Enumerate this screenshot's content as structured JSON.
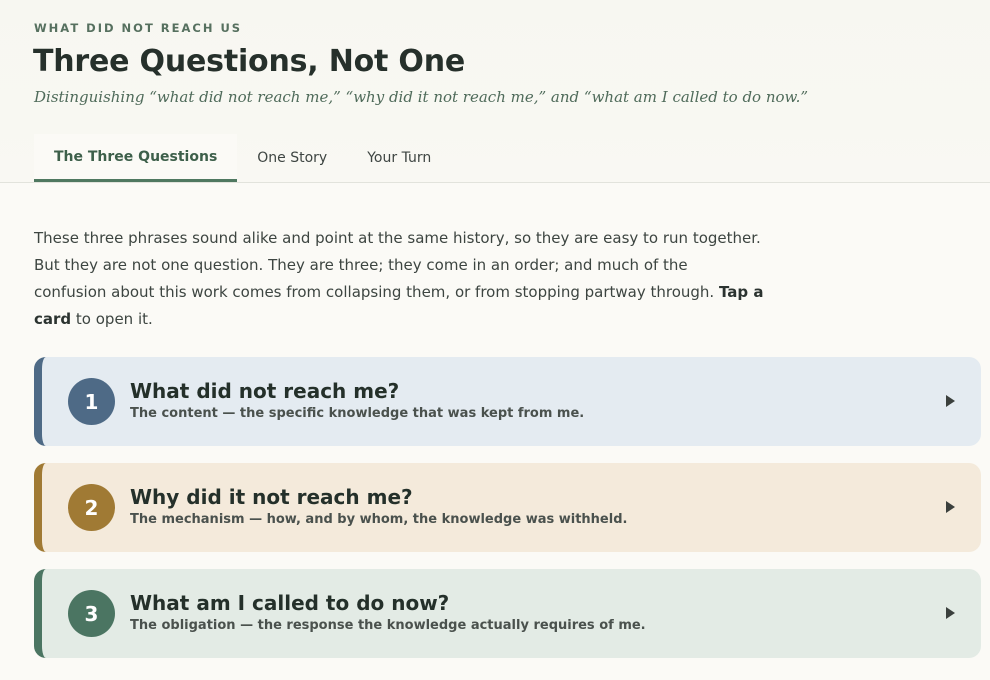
{
  "header": {
    "eyebrow": "WHAT DID NOT REACH US",
    "title": "Three Questions, Not One",
    "subtitle": "Distinguishing “what did not reach me,” “why did it not reach me,” and “what am I called to do now.”"
  },
  "tabs": [
    {
      "label": "The Three Questions",
      "active": true
    },
    {
      "label": "One Story",
      "active": false
    },
    {
      "label": "Your Turn",
      "active": false
    }
  ],
  "intro": {
    "text_before": "These three phrases sound alike and point at the same history, so they are easy to run together. But they are not one question. They are three; they come in an order; and much of the confusion about this work comes from collapsing them, or from stopping partway through. ",
    "emphasis": "Tap a card",
    "text_after": " to open it."
  },
  "cards": [
    {
      "number": "1",
      "question": "What did not reach me?",
      "description": "The content — the specific knowledge that was kept from me.",
      "color": "#4e6a86"
    },
    {
      "number": "2",
      "question": "Why did it not reach me?",
      "description": "The mechanism — how, and by whom, the knowledge was withheld.",
      "color": "#a07a34"
    },
    {
      "number": "3",
      "question": "What am I called to do now?",
      "description": "The obligation — the response the knowledge actually requires of me.",
      "color": "#4b7562"
    }
  ],
  "icons": {
    "expand": "play-arrow-icon"
  }
}
